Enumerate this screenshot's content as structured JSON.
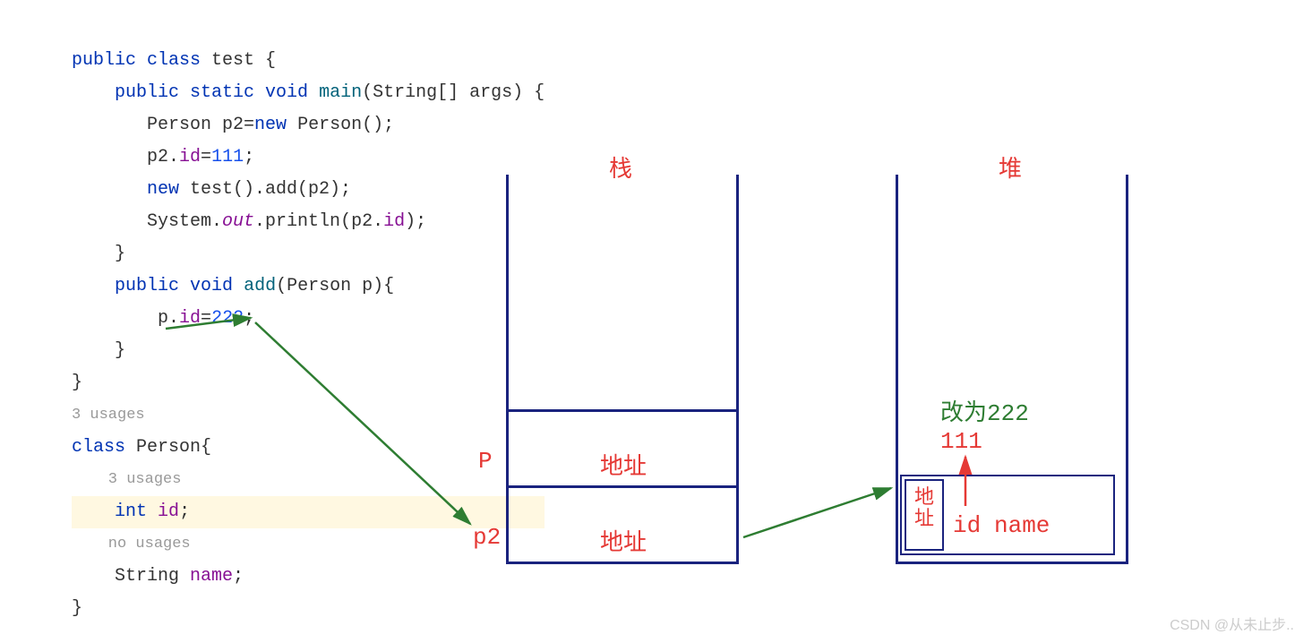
{
  "code": {
    "l1": "public class test {",
    "l2": "    public static void main(String[] args) {",
    "l3": "        Person p2=new Person();",
    "l4": "        p2.id=111;",
    "l5": "        new test().add(p2);",
    "l6": "        System.out.println(p2.id);",
    "l7": "    }",
    "l8": "    public void add(Person p){",
    "l9": "        p.id=222;",
    "l10": "    }",
    "l11": "}",
    "use3": "3 usages",
    "l12": "class Person{",
    "use3b": "    3 usages",
    "l13": "    int id;",
    "use0": "    no usages",
    "l14": "    String name;",
    "l15": "}"
  },
  "diagram": {
    "stack_title": "栈",
    "heap_title": "堆",
    "p_label": "P",
    "p2_label": "p2",
    "addr": "地址",
    "val_111": "111",
    "change_222": "改为222",
    "obj_addr": "地址",
    "obj_id": "id",
    "obj_name": "name"
  },
  "watermark": "CSDN @从未止步.."
}
